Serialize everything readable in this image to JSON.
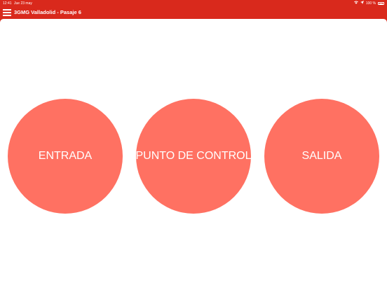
{
  "status_bar": {
    "time": "12:41",
    "date": "Jue 23 may",
    "signal_icon": "wifi-icon",
    "location_icon": "location-arrow-icon",
    "battery_text": "100 %",
    "battery_icon": "battery-icon"
  },
  "nav_bar": {
    "menu_icon": "hamburger-menu-icon",
    "title": "3GMG Valladolid - Pasaje 6"
  },
  "actions": {
    "entrada_label": "ENTRADA",
    "punto_control_label": "PUNTO DE CONTROL",
    "salida_label": "SALIDA"
  },
  "colors": {
    "header_background": "#d9291c",
    "button_background": "#ff7162",
    "content_background": "#ffffff",
    "text_on_color": "#ffffff"
  }
}
